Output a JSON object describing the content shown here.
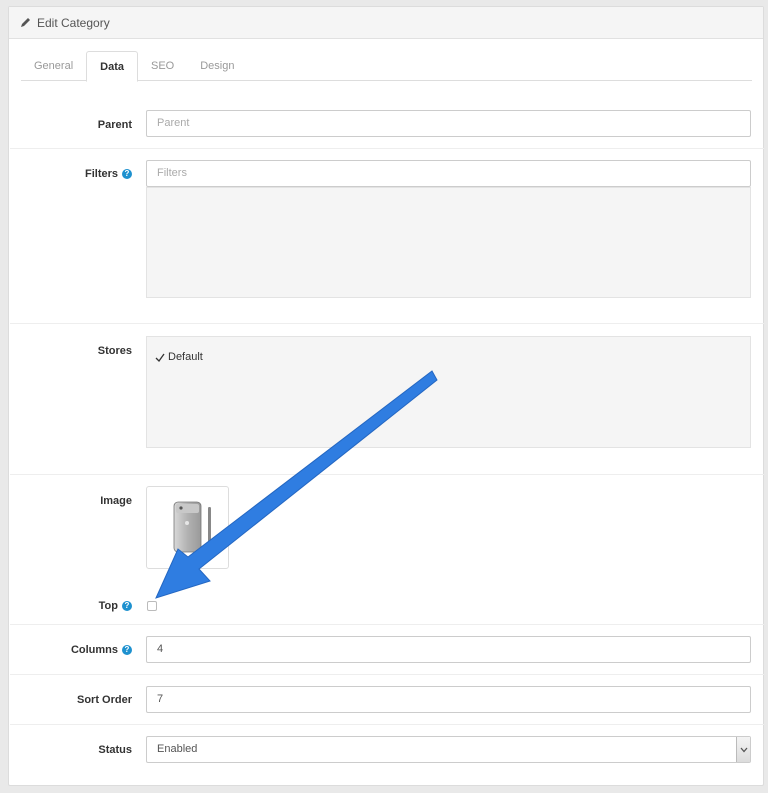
{
  "panel": {
    "title": "Edit Category"
  },
  "tabs": [
    "General",
    "Data",
    "SEO",
    "Design"
  ],
  "active_tab": "Data",
  "form": {
    "parent": {
      "label": "Parent",
      "placeholder": "Parent"
    },
    "filters": {
      "label": "Filters",
      "placeholder": "Filters"
    },
    "stores": {
      "label": "Stores",
      "items": [
        {
          "label": "Default",
          "checked": true
        }
      ]
    },
    "image": {
      "label": "Image"
    },
    "top": {
      "label": "Top",
      "checked": false
    },
    "columns": {
      "label": "Columns",
      "value": "4"
    },
    "sort_order": {
      "label": "Sort Order",
      "value": "7"
    },
    "status": {
      "label": "Status",
      "value": "Enabled"
    }
  },
  "colors": {
    "help_icon": "#1e91cf",
    "annotation_arrow": "#2f7de1"
  },
  "icons": {
    "heading": "pencil-icon",
    "help": "info-icon",
    "select": "chevron-down-icon"
  }
}
